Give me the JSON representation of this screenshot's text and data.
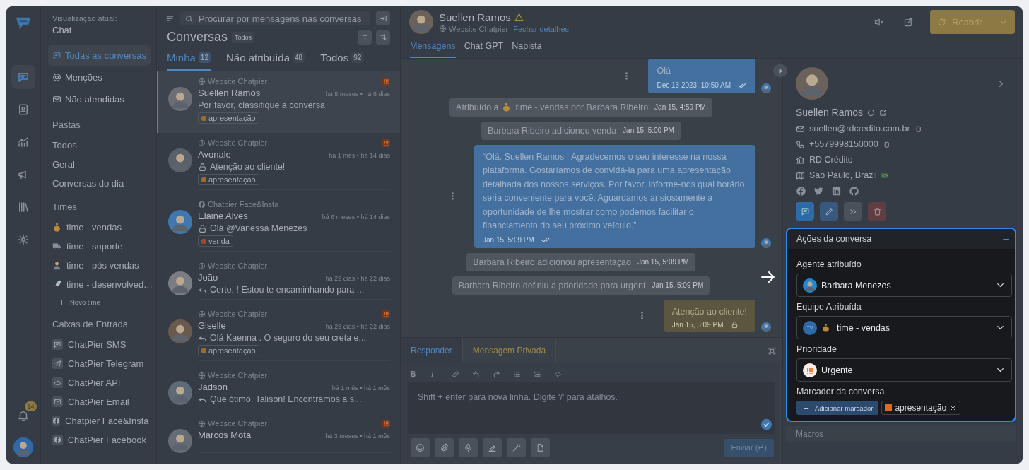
{
  "rail": {
    "items": [
      {
        "selected": true
      },
      {
        "selected": false
      },
      {
        "selected": false
      },
      {
        "selected": false
      },
      {
        "selected": false
      },
      {
        "selected": false
      }
    ],
    "notifications": "14"
  },
  "sidebar": {
    "view_label": "Visualização atual:",
    "view": "Chat",
    "nav": [
      {
        "kind": "chat",
        "label": "Todas as conversas",
        "selected": true
      },
      {
        "kind": "mention",
        "label": "Menções",
        "selected": false
      },
      {
        "kind": "unattended",
        "label": "Não atendidas",
        "selected": false
      }
    ],
    "folders": {
      "title": "Pastas",
      "items": [
        "Todos",
        "Geral",
        "Conversas do dia"
      ]
    },
    "teams": {
      "title": "Times",
      "items": [
        {
          "kind": "money",
          "label": "time - vendas"
        },
        {
          "kind": "truck",
          "label": "time - suporte"
        },
        {
          "kind": "person",
          "label": "time - pós vendas"
        },
        {
          "kind": "rocket",
          "label": "time - desenvolved…"
        }
      ],
      "add": "Novo time"
    },
    "inboxes": {
      "title": "Caixas de Entrada",
      "items": [
        {
          "kind": "sms",
          "label": "ChatPier SMS"
        },
        {
          "kind": "telegram",
          "label": "ChatPier Telegram"
        },
        {
          "kind": "api",
          "label": "ChatPier API"
        },
        {
          "kind": "email",
          "label": "ChatPier Email"
        },
        {
          "kind": "facebook",
          "label": "Chatpier Face&Insta"
        },
        {
          "kind": "facebook",
          "label": "ChatPier Facebook"
        }
      ]
    }
  },
  "conversations": {
    "search_placeholder": "Procurar por mensagens nas conversas",
    "title": "Conversas",
    "filter_badge": "Todos",
    "tabs": [
      {
        "label": "Minha",
        "count": "12",
        "selected": true
      },
      {
        "label": "Não atribuída",
        "count": "48",
        "selected": false
      },
      {
        "label": "Todos",
        "count": "92",
        "selected": false
      }
    ],
    "items": [
      {
        "channel": {
          "kind": "web",
          "label": "Website Chatpier"
        },
        "name": "Suellen Ramos",
        "time": "há 5 meses • há 6 dias",
        "preview": {
          "kind": "plain",
          "text": "Por favor, classifique a conversa"
        },
        "tag": {
          "label": "apresentação",
          "color": "#a06a2c"
        },
        "urgent": true,
        "selected": true
      },
      {
        "channel": {
          "kind": "web",
          "label": "Website Chatpier"
        },
        "name": "Avonale",
        "time": "há 1 mês • há 14 dias",
        "preview": {
          "kind": "private",
          "text": "Atenção ao cliente!"
        },
        "tag": {
          "label": "apresentação",
          "color": "#a06a2c"
        },
        "urgent": true,
        "selected": false
      },
      {
        "channel": {
          "kind": "facebook",
          "label": "Chatpier Face&Insta"
        },
        "name": "Elaine Alves",
        "time": "há 6 meses • há 14 dias",
        "preview": {
          "kind": "private",
          "text": "Olá @Vanessa Menezes"
        },
        "tag": {
          "label": "venda",
          "color": "#a0462c"
        },
        "urgent": false,
        "selected": false
      },
      {
        "channel": {
          "kind": "web",
          "label": "Website Chatpier"
        },
        "name": "João",
        "time": "há 22 dias • há 22 dias",
        "preview": {
          "kind": "reply",
          "text": "Certo, ! Estou te encaminhando para ..."
        },
        "urgent": false,
        "selected": false
      },
      {
        "channel": {
          "kind": "web",
          "label": "Website Chatpier"
        },
        "name": "Giselle",
        "time": "há 28 dias • há 22 dias",
        "preview": {
          "kind": "reply",
          "text": "Olá Kaenna . O seguro do seu creta e..."
        },
        "tag": {
          "label": "apresentação",
          "color": "#a06a2c"
        },
        "urgent": true,
        "selected": false
      },
      {
        "channel": {
          "kind": "web",
          "label": "Website Chatpier"
        },
        "name": "Jadson",
        "time": "há 1 mês • há 1 mês",
        "preview": {
          "kind": "reply",
          "text": "Que ótimo, Talison! Encontramos a s..."
        },
        "urgent": false,
        "selected": false
      },
      {
        "channel": {
          "kind": "web",
          "label": "Website Chatpier"
        },
        "name": "Marcos Mota",
        "time": "há 3 meses • há 1 mês",
        "urgent": true,
        "selected": false
      }
    ]
  },
  "chat": {
    "contact": {
      "name": "Suellen Ramos",
      "warning": true,
      "channel": "Website Chatpier",
      "close_details": "Fechar detalhes"
    },
    "reopen": "Reabrir",
    "tabs": [
      {
        "label": "Mensagens",
        "selected": true
      },
      {
        "label": "Chat GPT",
        "selected": false
      },
      {
        "label": "Napista",
        "selected": false
      }
    ],
    "messages": [
      {
        "kind": "outgoing",
        "text": "Olá",
        "time": "Dec 13 2023, 10:50 AM"
      },
      {
        "kind": "activity",
        "text": "Atribuído a",
        "after_icon": "time - vendas por Barbara Ribeiro",
        "time": "Jan 15, 4:59 PM"
      },
      {
        "kind": "activity",
        "text": "Barbara Ribeiro adicionou venda",
        "time": "Jan 15, 5:00 PM"
      },
      {
        "kind": "outgoing",
        "text": "“Olá, Suellen Ramos ! Agradecemos o seu interesse na nossa plataforma. Gostaríamos de convidá-la para uma apresentação detalhada dos nossos serviços. Por favor, informe-nos qual horário seria conveniente para você. Aguardamos ansiosamente a oportunidade de lhe mostrar como podemos facilitar o financiamento do seu próximo veículo.”",
        "time": "Jan 15, 5:09 PM"
      },
      {
        "kind": "activity",
        "text": "Barbara Ribeiro adicionou apresentação",
        "time": "Jan 15, 5:09 PM"
      },
      {
        "kind": "activity",
        "text": "Barbara Ribeiro definiu a prioridade para urgent",
        "time": "Jan 15, 5:09 PM"
      },
      {
        "kind": "private",
        "text": "Atenção ao cliente!",
        "time": "Jan 15, 5:09 PM"
      }
    ],
    "composer": {
      "tabs": [
        {
          "kind": "reply",
          "label": "Responder",
          "selected": true
        },
        {
          "kind": "private",
          "label": "Mensagem Privada",
          "selected": false
        }
      ],
      "bold": "B",
      "italic": "I",
      "placeholder": "Shift + enter para nova linha. Digite '/' para atalhos.",
      "send": "Enviar (↵)"
    }
  },
  "contact_panel": {
    "name": "Suellen Ramos",
    "email": "suellen@rdcredito.com.br",
    "phone": "+5579998150000",
    "company": "RD Crédito",
    "location": "São Paulo, Brazil"
  },
  "actions_panel": {
    "title": "Ações da conversa",
    "expanded": true,
    "fields": [
      {
        "kind": "agent",
        "label": "Agente atribuído",
        "value": "Barbara Menezes"
      },
      {
        "kind": "team",
        "label": "Equipe Atribuída",
        "badge": "TV",
        "value": "time - vendas"
      },
      {
        "kind": "priority",
        "label": "Prioridade",
        "value": "Urgente"
      }
    ],
    "labels": {
      "title": "Marcador da conversa",
      "add": "Adicionar marcador",
      "tags": [
        {
          "label": "apresentação",
          "color": "#e8661c"
        }
      ]
    }
  },
  "macros": {
    "title": "Macros"
  }
}
